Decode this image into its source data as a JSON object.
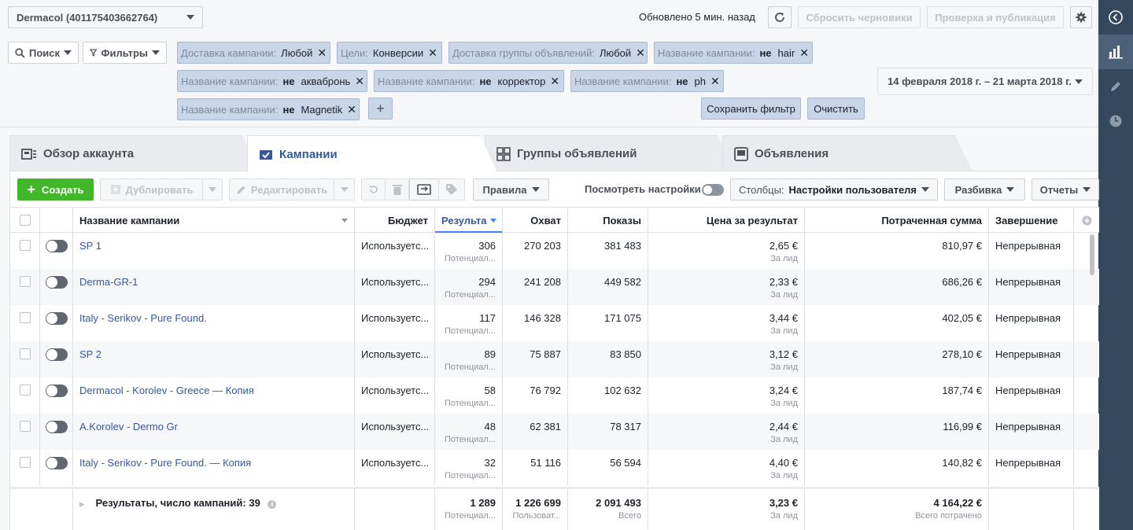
{
  "header": {
    "account": "Dermacol (401175403662764)",
    "updated": "Обновлено 5 мин. назад",
    "discard": "Сбросить черновики",
    "review": "Проверка и публикация"
  },
  "filters": {
    "search": "Поиск",
    "filters": "Фильтры",
    "chips": [
      {
        "key": "Доставка кампании:",
        "ne": "",
        "value": "Любой"
      },
      {
        "key": "Цели:",
        "ne": "",
        "value": "Конверсии"
      },
      {
        "key": "Доставка группы объявлений:",
        "ne": "",
        "value": "Любой"
      },
      {
        "key": "Название кампании:",
        "ne": "не",
        "value": "hair"
      },
      {
        "key": "Название кампании:",
        "ne": "не",
        "value": "аквабронь"
      },
      {
        "key": "Название кампании:",
        "ne": "не",
        "value": "корректор"
      },
      {
        "key": "Название кампании:",
        "ne": "не",
        "value": "ph"
      },
      {
        "key": "Название кампании:",
        "ne": "не",
        "value": "Magnetik"
      }
    ],
    "date_range": "14 февраля 2018 г. – 21 марта 2018 г.",
    "save_filter": "Сохранить фильтр",
    "clear": "Очистить"
  },
  "tabs": [
    {
      "label": "Обзор аккаунта"
    },
    {
      "label": "Кампании"
    },
    {
      "label": "Группы объявлений"
    },
    {
      "label": "Объявления"
    }
  ],
  "toolbar": {
    "create": "Создать",
    "duplicate": "Дублировать",
    "edit": "Редактировать",
    "rules": "Правила",
    "view_settings": "Посмотреть настройки",
    "columns_prefix": "Столбцы:",
    "columns_value": "Настройки пользователя",
    "breakdown": "Разбивка",
    "reports": "Отчеты"
  },
  "table": {
    "headers": [
      "Название кампании",
      "Бюджет",
      "Результа",
      "Охват",
      "Показы",
      "Цена за результат",
      "Потраченная сумма",
      "Завершение"
    ],
    "rows": [
      {
        "name": "SP 1",
        "budget": "Используетс...",
        "results": "306",
        "results_sub": "Потенциал...",
        "reach": "270 203",
        "impressions": "381 483",
        "cpr": "2,65 €",
        "cpr_sub": "За лид",
        "spent": "810,97 €",
        "end": "Непрерывная"
      },
      {
        "name": "Derma-GR-1",
        "budget": "Используетс...",
        "results": "294",
        "results_sub": "Потенциал...",
        "reach": "241 208",
        "impressions": "449 582",
        "cpr": "2,33 €",
        "cpr_sub": "За лид",
        "spent": "686,26 €",
        "end": "Непрерывная"
      },
      {
        "name": "Italy - Serikov - Pure Found.",
        "budget": "Используетс...",
        "results": "117",
        "results_sub": "Потенциал...",
        "reach": "146 328",
        "impressions": "171 075",
        "cpr": "3,44 €",
        "cpr_sub": "За лид",
        "spent": "402,05 €",
        "end": "Непрерывная"
      },
      {
        "name": "SP 2",
        "budget": "Используетс...",
        "results": "89",
        "results_sub": "Потенциал...",
        "reach": "75 887",
        "impressions": "83 850",
        "cpr": "3,12 €",
        "cpr_sub": "За лид",
        "spent": "278,10 €",
        "end": "Непрерывная"
      },
      {
        "name": "Dermacol - Korolev - Greece — Копия",
        "budget": "Используетс...",
        "results": "58",
        "results_sub": "Потенциал...",
        "reach": "76 792",
        "impressions": "102 632",
        "cpr": "3,24 €",
        "cpr_sub": "За лид",
        "spent": "187,74 €",
        "end": "Непрерывная"
      },
      {
        "name": "A.Korolev - Dermo Gr",
        "budget": "Используетс...",
        "results": "48",
        "results_sub": "Потенциал...",
        "reach": "62 381",
        "impressions": "78 317",
        "cpr": "2,44 €",
        "cpr_sub": "За лид",
        "spent": "116,99 €",
        "end": "Непрерывная"
      },
      {
        "name": "Italy - Serikov - Pure Found. — Копия",
        "budget": "Используетс...",
        "results": "32",
        "results_sub": "Потенциал...",
        "reach": "51 116",
        "impressions": "56 594",
        "cpr": "4,40 €",
        "cpr_sub": "За лид",
        "spent": "140,82 €",
        "end": "Непрерывная"
      }
    ],
    "footer": {
      "label": "Результаты, число кампаний: 39",
      "results": "1 289",
      "results_sub": "Потенциал...",
      "reach": "1 226 699",
      "reach_sub": "Пользоват...",
      "impressions": "2 091 493",
      "impressions_sub": "Всего",
      "cpr": "3,23 €",
      "cpr_sub": "За лид",
      "spent": "4 164,22 €",
      "spent_sub": "Всего потрачено"
    }
  },
  "colors": {
    "accent": "#365899",
    "create": "#42b72a",
    "rail": "#34495e"
  }
}
